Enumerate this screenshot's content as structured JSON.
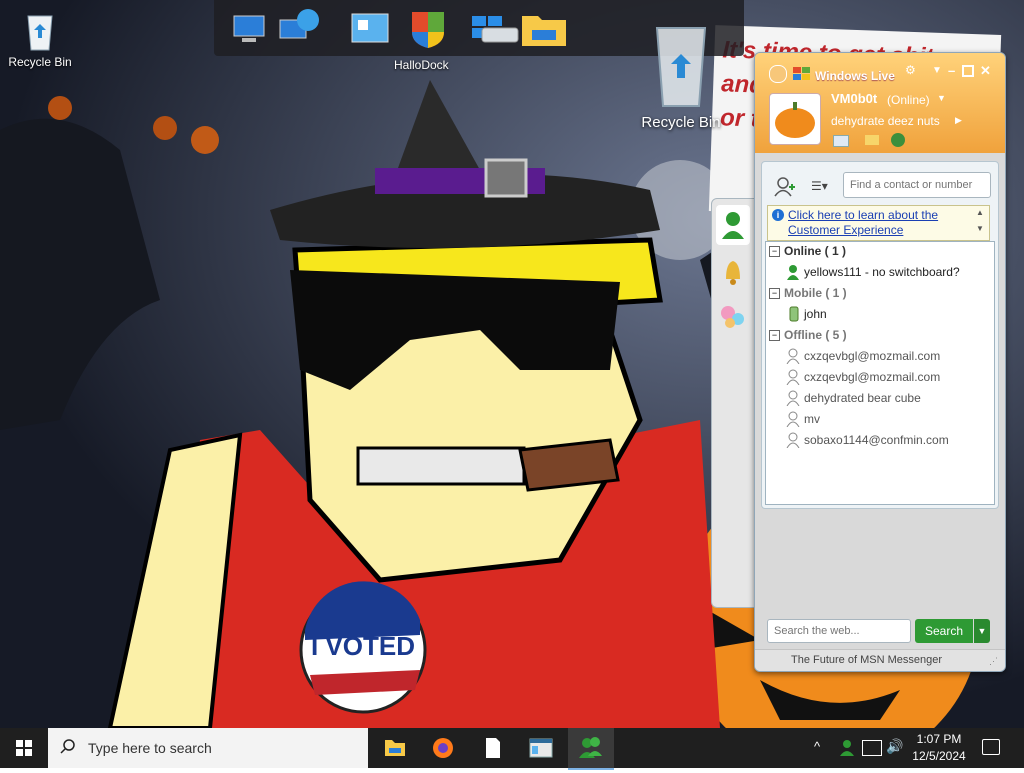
{
  "desktop": {
    "recycle_bin_label": "Recycle Bin",
    "recycle_bin_large_label": "Recycle Bin",
    "hallodock_label": "HalloDock",
    "poster_lines": [
      "It's time to get shit",
      "and",
      "or t"
    ],
    "badge_text": "I VOTED"
  },
  "msn": {
    "title": "Windows Live",
    "username": "VM0b0t",
    "status": "(Online)",
    "personal_message": "dehydrate deez nuts",
    "find_placeholder": "Find a contact or number",
    "info_text": "Click here to learn about the Customer Experience",
    "groups": [
      {
        "label": "Online ( 1 )",
        "contacts": [
          "yellows111 - no switchboard?"
        ]
      },
      {
        "label": "Mobile ( 1 )",
        "contacts": [
          "john"
        ]
      },
      {
        "label": "Offline ( 5 )",
        "contacts": [
          "cxzqevbgl@mozmail.com",
          "cxzqevbgl@mozmail.com",
          "dehydrated bear cube",
          "mv",
          "sobaxo1144@confmin.com"
        ]
      }
    ],
    "web_search_placeholder": "Search the web...",
    "search_button": "Search",
    "footer": "The Future of MSN Messenger"
  },
  "taskbar": {
    "search_placeholder": "Type here to search",
    "time": "1:07 PM",
    "date": "12/5/2024"
  },
  "colors": {
    "msn_accent": "#f5a640",
    "search_green": "#2e9a34",
    "taskbar_bg": "#1f1f1f"
  }
}
